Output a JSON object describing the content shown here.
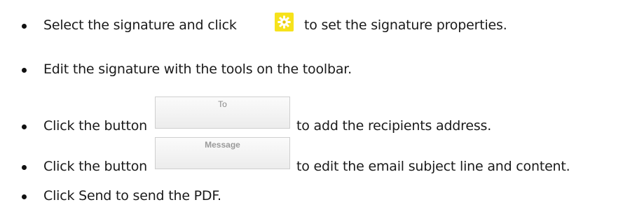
{
  "steps": [
    {
      "before": "Select the signature and click",
      "icon": "gear-icon",
      "after": "to set the signature properties."
    },
    {
      "text": "Edit the signature with the tools on the toolbar."
    },
    {
      "before": "Click the button",
      "button_label": "To",
      "after": "to add the recipients address."
    },
    {
      "before": "Click the button",
      "button_label": "Message",
      "after": "to edit the email subject line and content."
    },
    {
      "text": "Click Send to send the PDF."
    }
  ],
  "colors": {
    "gear_background": "#f6e21c",
    "gear_foreground": "#ffffff",
    "button_text": "#8a8a8a"
  }
}
